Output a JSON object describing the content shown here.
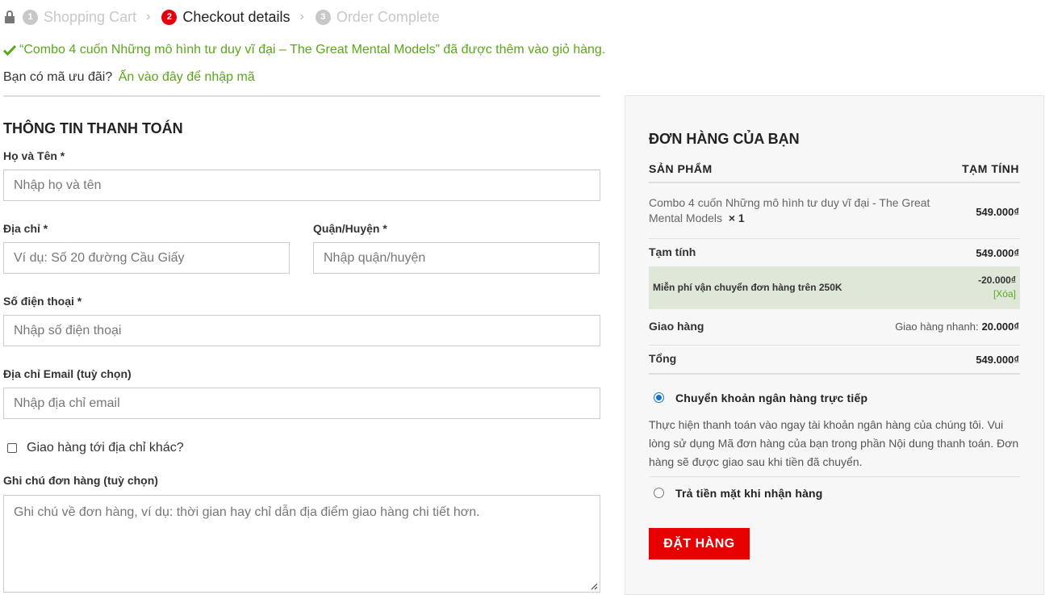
{
  "steps": [
    {
      "number": "1",
      "label": "Shopping Cart"
    },
    {
      "number": "2",
      "label": "Checkout details"
    },
    {
      "number": "3",
      "label": "Order Complete"
    }
  ],
  "notice": "“Combo 4 cuốn Những mô hình tư duy vĩ đại – The Great Mental Models” đã được thêm vào giỏ hàng.",
  "coupon": {
    "question": "Bạn có mã ưu đãi?",
    "link": "Ấn vào đây để nhập mã"
  },
  "billing": {
    "title": "THÔNG TIN THANH TOÁN",
    "name": {
      "label": "Họ và Tên *",
      "placeholder": "Nhập họ và tên"
    },
    "address": {
      "label": "Địa chỉ *",
      "placeholder": "Ví dụ: Số 20 đường Cầu Giấy"
    },
    "district": {
      "label": "Quận/Huyện *",
      "placeholder": "Nhập quận/huyện"
    },
    "phone": {
      "label": "Số điện thoại *",
      "placeholder": "Nhập số điện thoại"
    },
    "email": {
      "label": "Địa chỉ Email (tuỳ chọn)",
      "placeholder": "Nhập địa chỉ email"
    },
    "ship_other": "Giao hàng tới địa chỉ khác?",
    "notes": {
      "label": "Ghi chú đơn hàng (tuỳ chọn)",
      "placeholder": "Ghi chú về đơn hàng, ví dụ: thời gian hay chỉ dẫn địa điểm giao hàng chi tiết hơn."
    }
  },
  "order": {
    "title": "ĐƠN HÀNG CỦA BẠN",
    "col_product": "SẢN PHẨM",
    "col_subtotal": "TẠM TÍNH",
    "product": {
      "name": "Combo 4 cuốn Những mô hình tư duy vĩ đại - The Great Mental Models",
      "qty": "× 1",
      "price": "549.000₫"
    },
    "subtotal": {
      "label": "Tạm tính",
      "value": "549.000₫"
    },
    "discount": {
      "label": "Miễn phí vận chuyển đơn hàng trên 250K",
      "value": "-20.000₫",
      "remove": "[Xóa]"
    },
    "shipping": {
      "label": "Giao hàng",
      "method": "Giao hàng nhanh:",
      "value": "20.000₫"
    },
    "total": {
      "label": "Tổng",
      "value": "549.000₫"
    },
    "payment": {
      "bank": "Chuyển khoản ngân hàng trực tiếp",
      "bank_desc": "Thực hiện thanh toán vào ngay tài khoản ngân hàng của chúng tôi. Vui lòng sử dụng Mã đơn hàng của bạn trong phần Nội dung thanh toán. Đơn hàng sẽ được giao sau khi tiền đã chuyển.",
      "cod": "Trả tiền mặt khi nhận hàng",
      "selected": "bank"
    },
    "place_order": "ĐẶT HÀNG"
  },
  "colors": {
    "accent_red": "#e60000",
    "success_green": "#5ba71b",
    "radio_blue": "#0b74d8"
  }
}
